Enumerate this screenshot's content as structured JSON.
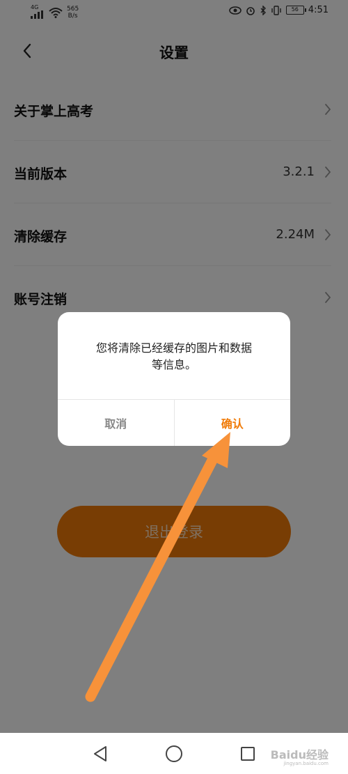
{
  "status_bar": {
    "network": "4G",
    "speed_value": "565",
    "speed_unit": "B/s",
    "battery": "56",
    "time": "4:51"
  },
  "header": {
    "title": "设置"
  },
  "settings": {
    "items": [
      {
        "label": "关于掌上高考",
        "value": ""
      },
      {
        "label": "当前版本",
        "value": "3.2.1"
      },
      {
        "label": "清除缓存",
        "value": "2.24M"
      },
      {
        "label": "账号注销",
        "value": ""
      }
    ]
  },
  "logout": {
    "label": "退出登录"
  },
  "dialog": {
    "message_line1": "您将清除已经缓存的图片和数据",
    "message_line2": "等信息。",
    "cancel_label": "取消",
    "confirm_label": "确认"
  },
  "watermark": {
    "text": "Baidu经验",
    "url": "jingyan.baidu.com"
  },
  "colors": {
    "accent": "#f07b08",
    "annotation_arrow": "#f7923a"
  }
}
